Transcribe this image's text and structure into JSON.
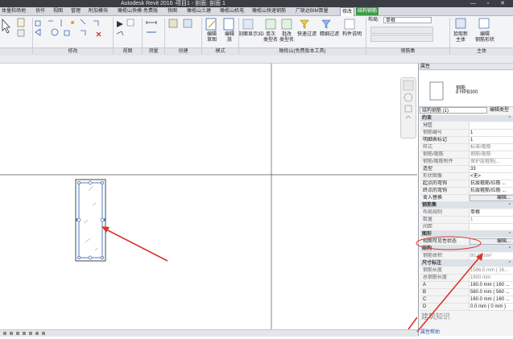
{
  "window": {
    "title": "Autodesk Revit 2016 -",
    "document": "项目1 - 剖面: 剖面 1",
    "controls": "— ▫ ✕"
  },
  "tabs": [
    {
      "label": "体量和场地"
    },
    {
      "label": "协作"
    },
    {
      "label": "视图"
    },
    {
      "label": "管理"
    },
    {
      "label": "附加模块"
    },
    {
      "label": "橄榄山快模-免费版"
    },
    {
      "label": "快图"
    },
    {
      "label": "橄榄山土建"
    },
    {
      "label": "橄榄山机电"
    },
    {
      "label": "橄榄山快速钢筋"
    },
    {
      "label": "广联达BIM算量"
    },
    {
      "label": "修改"
    },
    {
      "label": "结构钢筋"
    }
  ],
  "ribbon": {
    "panels": [
      {
        "title": "修改"
      },
      {
        "title": "视图"
      },
      {
        "title": "测量"
      },
      {
        "title": "创建"
      },
      {
        "title": "模式"
      },
      {
        "title": "橄榄山(免费版本工具)"
      },
      {
        "title": "钢筋集"
      },
      {
        "title": "主体"
      }
    ],
    "mode_buttons": [
      {
        "label": "编辑\n草图"
      },
      {
        "label": "编辑\n族"
      }
    ],
    "tool_buttons": [
      {
        "label": "剖面显示3D"
      },
      {
        "label": "单次\n类型名"
      },
      {
        "label": "批改\n类型名"
      },
      {
        "label": "快速过滤"
      },
      {
        "label": "精细过滤"
      },
      {
        "label": "构件说明"
      }
    ],
    "rebar_set": {
      "layout_label": "布局:",
      "layout_value": "单根"
    },
    "host_buttons": [
      {
        "label": "拾取新\n主体"
      },
      {
        "label": "编辑\n钢筋形状"
      }
    ]
  },
  "properties": {
    "panel_title": "属性",
    "type_name": "钢筋",
    "type_sub": "8 HPB300",
    "selector": "结构钢筋 (1)",
    "edit_type": "编辑类型",
    "groups": [
      {
        "title": "约束",
        "rows": []
      },
      {
        "title": "",
        "rows": [
          {
            "key": "分区",
            "value": "",
            "dark": true
          },
          {
            "key": "钢筋编号",
            "value": "1"
          },
          {
            "key": "明细表标记",
            "value": "1",
            "dark": true
          },
          {
            "key": "样式",
            "value": "标准/箍筋",
            "grey": true
          },
          {
            "key": "钢筋/箍筋",
            "value": "钢筋/箍筋",
            "grey": true
          },
          {
            "key": "钢筋/箍筋附件",
            "value": "保护层箍筋(...",
            "grey": true
          },
          {
            "key": "造型",
            "value": "33",
            "dark": true
          },
          {
            "key": "形状图像",
            "value": "<无>"
          },
          {
            "key": "起点的弯钩",
            "value": "抗震箍筋/拉筋 ...",
            "dark": true
          },
          {
            "key": "终点的弯钩",
            "value": "抗震箍筋/拉筋 ...",
            "dark": true
          },
          {
            "key": "舍入替换",
            "value": "编辑...",
            "button": true,
            "dark": true
          }
        ]
      },
      {
        "title": "钢筋集",
        "rows": [
          {
            "key": "布局规则",
            "value": "单根"
          },
          {
            "key": "数量",
            "value": "1",
            "grey": true
          },
          {
            "key": "间距",
            "value": "",
            "grey": true
          }
        ]
      },
      {
        "title": "图形",
        "rows": [
          {
            "key": "视图可见性状态",
            "value": "编辑...",
            "button": true,
            "dark": true
          }
        ]
      },
      {
        "title": "结构",
        "rows": [
          {
            "key": "钢筋体积",
            "value": "80.42 cm³",
            "grey": true
          }
        ]
      },
      {
        "title": "尺寸标注",
        "rows": [
          {
            "key": "钢筋长度",
            "value": "1596.5 mm ( 16...",
            "grey": true
          },
          {
            "key": "总钢筋长度",
            "value": "1600 mm",
            "grey": true
          },
          {
            "key": "A",
            "value": "160.0 mm ( 160 ...",
            "dark": true
          },
          {
            "key": "B",
            "value": "560.0 mm ( 560 ...",
            "dark": true
          },
          {
            "key": "C",
            "value": "160.0 mm ( 160 ...",
            "dark": true
          },
          {
            "key": "D",
            "value": "0.0 mm ( 0 mm )",
            "dark": true
          }
        ]
      }
    ],
    "help_link": "属性帮助"
  },
  "watermark": "建筑知识"
}
